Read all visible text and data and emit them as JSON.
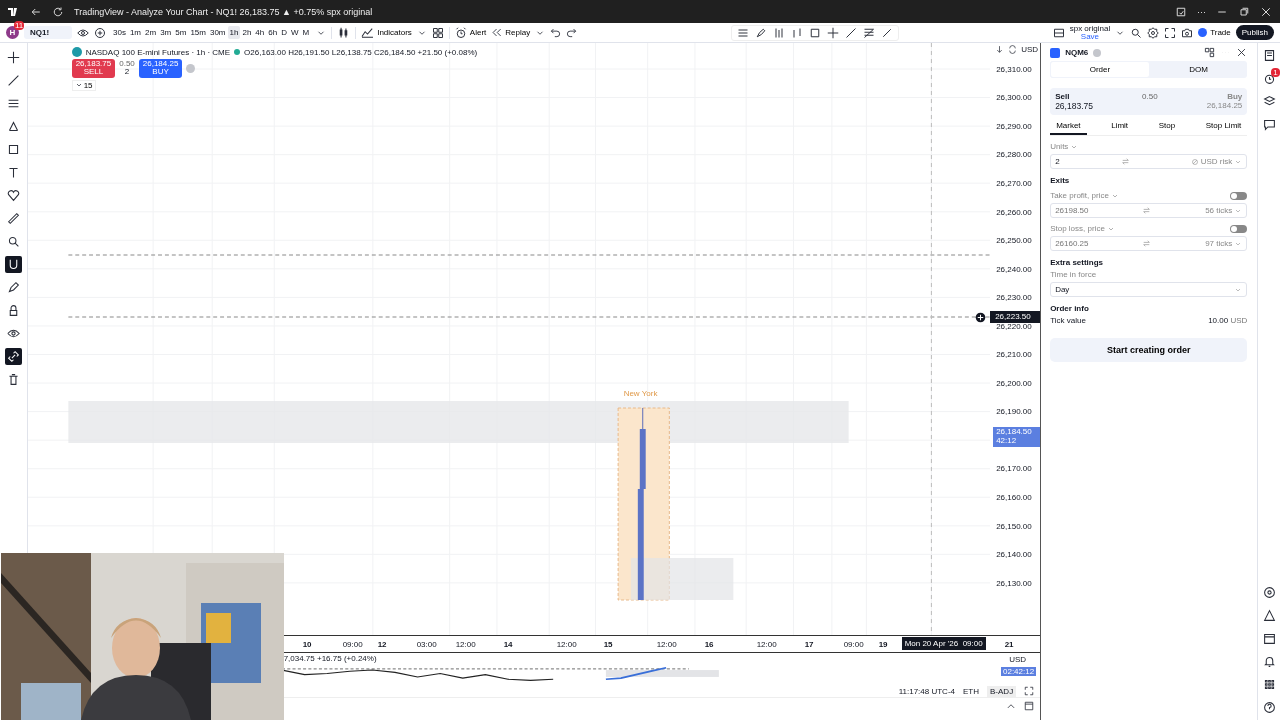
{
  "browser": {
    "title": "TradingView - Analyze Your Chart - NQ1! 26,183.75 ▲ +0.75% spx original",
    "more": "···"
  },
  "toolbar": {
    "avatar": "H",
    "notifications": "11",
    "symbol": "NQ1!",
    "timeframes": [
      {
        "label": "30s",
        "selected": false
      },
      {
        "label": "1m",
        "selected": false
      },
      {
        "label": "2m",
        "selected": false
      },
      {
        "label": "3m",
        "selected": false
      },
      {
        "label": "5m",
        "selected": false
      },
      {
        "label": "15m",
        "selected": false
      },
      {
        "label": "30m",
        "selected": false
      },
      {
        "label": "1h",
        "selected": true
      },
      {
        "label": "2h",
        "selected": false
      },
      {
        "label": "4h",
        "selected": false
      },
      {
        "label": "6h",
        "selected": false
      },
      {
        "label": "D",
        "selected": false
      },
      {
        "label": "W",
        "selected": false
      },
      {
        "label": "M",
        "selected": false
      }
    ],
    "indicators": "Indicators",
    "alert": "Alert",
    "replay": "Replay",
    "layout_name": "spx original",
    "save": "Save",
    "trade": "Trade",
    "publish": "Publish"
  },
  "chart": {
    "title": "NASDAQ 100 E-mini Futures · 1h · CME",
    "ohlc": "O26,163.00 H26,191.50 L26,138.75 C26,184.50 +21.50 (+0.08%)",
    "sell_price": "26,183.75",
    "sell_label": "SELL",
    "spread": "0.50",
    "quantity": "2",
    "buy_price": "26,184.25",
    "buy_label": "BUY",
    "indicator_count": "15",
    "session_label": "New York",
    "currency": "USD",
    "price_ticks": [
      "26,310.00",
      "26,300.00",
      "26,290.00",
      "26,280.00",
      "26,270.00",
      "26,260.00",
      "26,250.00",
      "26,240.00",
      "26,230.00",
      "26,220.00",
      "26,210.00",
      "26,200.00",
      "26,190.00",
      "26,170.00",
      "26,160.00",
      "26,150.00",
      "26,140.00",
      "26,130.00"
    ],
    "crosshair_price": "26,223.50",
    "last_price": "26,184.50",
    "countdown": "42:12",
    "time_ticks": [
      {
        "label": "10",
        "kind": "day"
      },
      {
        "label": "09:00",
        "kind": "time"
      },
      {
        "label": "12",
        "kind": "day"
      },
      {
        "label": "03:00",
        "kind": "time"
      },
      {
        "label": "12:00",
        "kind": "time"
      },
      {
        "label": "14",
        "kind": "day"
      },
      {
        "label": "12:00",
        "kind": "time"
      },
      {
        "label": "15",
        "kind": "day"
      },
      {
        "label": "12:00",
        "kind": "time"
      },
      {
        "label": "16",
        "kind": "day"
      },
      {
        "label": "12:00",
        "kind": "time"
      },
      {
        "label": "17",
        "kind": "day"
      },
      {
        "label": "09:00",
        "kind": "time"
      },
      {
        "label": "19",
        "kind": "day"
      },
      {
        "label": "21",
        "kind": "day"
      }
    ],
    "crosshair_time": "Mon 20 Apr '26  09:00"
  },
  "mini_panel": {
    "quote": "7,034.75 +16.75 (+0.24%)",
    "currency": "USD",
    "countdown": "02:42:12",
    "clock": "11:17:48 UTC-4",
    "session": "ETH",
    "adjustment": "B-ADJ"
  },
  "order_panel": {
    "symbol": "NQM6",
    "tabs": [
      {
        "label": "Order",
        "selected": true
      },
      {
        "label": "DOM",
        "selected": false
      }
    ],
    "sell_label": "Sell",
    "sell_price": "26,183.75",
    "spread": "0.50",
    "buy_label": "Buy",
    "buy_price": "26,184.25",
    "order_types": [
      {
        "label": "Market",
        "selected": true
      },
      {
        "label": "Limit",
        "selected": false
      },
      {
        "label": "Stop",
        "selected": false
      },
      {
        "label": "Stop Limit",
        "selected": false
      }
    ],
    "units_label": "Units",
    "units_value": "2",
    "risk_label": "USD risk",
    "exits_title": "Exits",
    "take_profit": {
      "label": "Take profit, price",
      "on": false,
      "price": "26198.50",
      "ticks": "56 ticks"
    },
    "stop_loss": {
      "label": "Stop loss, price",
      "on": false,
      "price": "26160.25",
      "ticks": "97 ticks"
    },
    "extra_title": "Extra settings",
    "tif_label": "Time in force",
    "tif_value": "Day",
    "info_title": "Order info",
    "tick_label": "Tick value",
    "tick_value": "10.00",
    "tick_unit": "USD",
    "submit": "Start creating order"
  },
  "side_strip": {
    "alert_badge": "1"
  }
}
